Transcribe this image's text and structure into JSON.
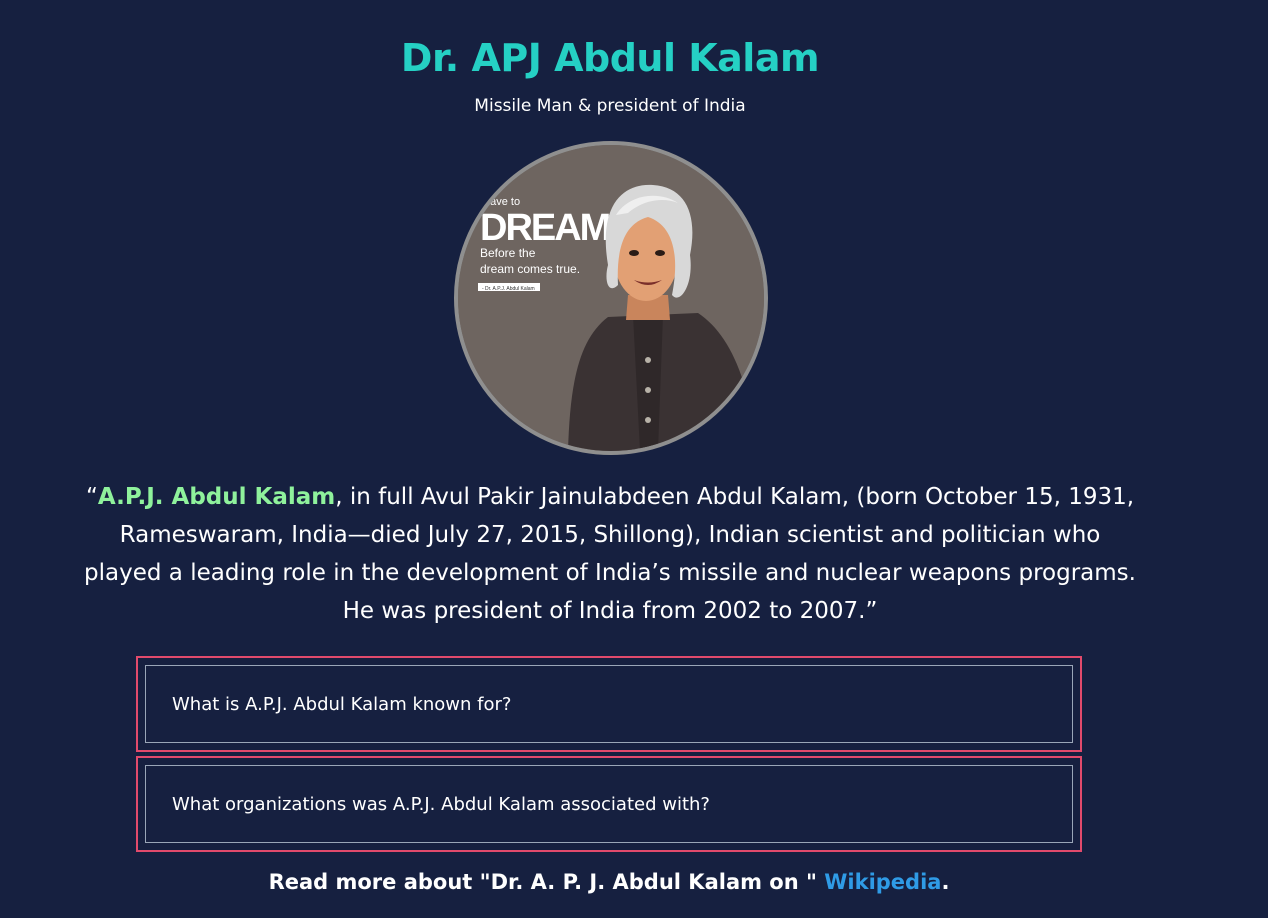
{
  "header": {
    "title": "Dr. APJ Abdul Kalam",
    "subtitle": "Missile Man & president of India"
  },
  "portrait": {
    "caption_line1": "have to",
    "caption_line2": "DREAM",
    "caption_line3": "Before the",
    "caption_line4": "dream comes true.",
    "caption_credit": "- Dr. A.P.J. Abdul Kalam"
  },
  "quote": {
    "open": "“",
    "name": "A.P.J. Abdul Kalam",
    "text": ", in full Avul Pakir Jainulabdeen Abdul Kalam, (born October 15, 1931, Rameswaram, India—died July 27, 2015, Shillong), Indian scientist and politician who played a leading role in the development of India’s missile and nuclear weapons programs. He was president of India from 2002 to 2007.",
    "close": "”"
  },
  "faq": [
    {
      "question": "What is A.P.J. Abdul Kalam known for?"
    },
    {
      "question": "What organizations was A.P.J. Abdul Kalam associated with?"
    }
  ],
  "footer": {
    "prefix": "Read more about \"Dr. A. P. J. Abdul Kalam on \" ",
    "link_label": "Wikipedia",
    "suffix": "."
  },
  "colors": {
    "background": "#162040",
    "title": "#25d0c4",
    "highlight": "#8ff29c",
    "faq_border": "#e24a6c",
    "link": "#2f9be6"
  }
}
